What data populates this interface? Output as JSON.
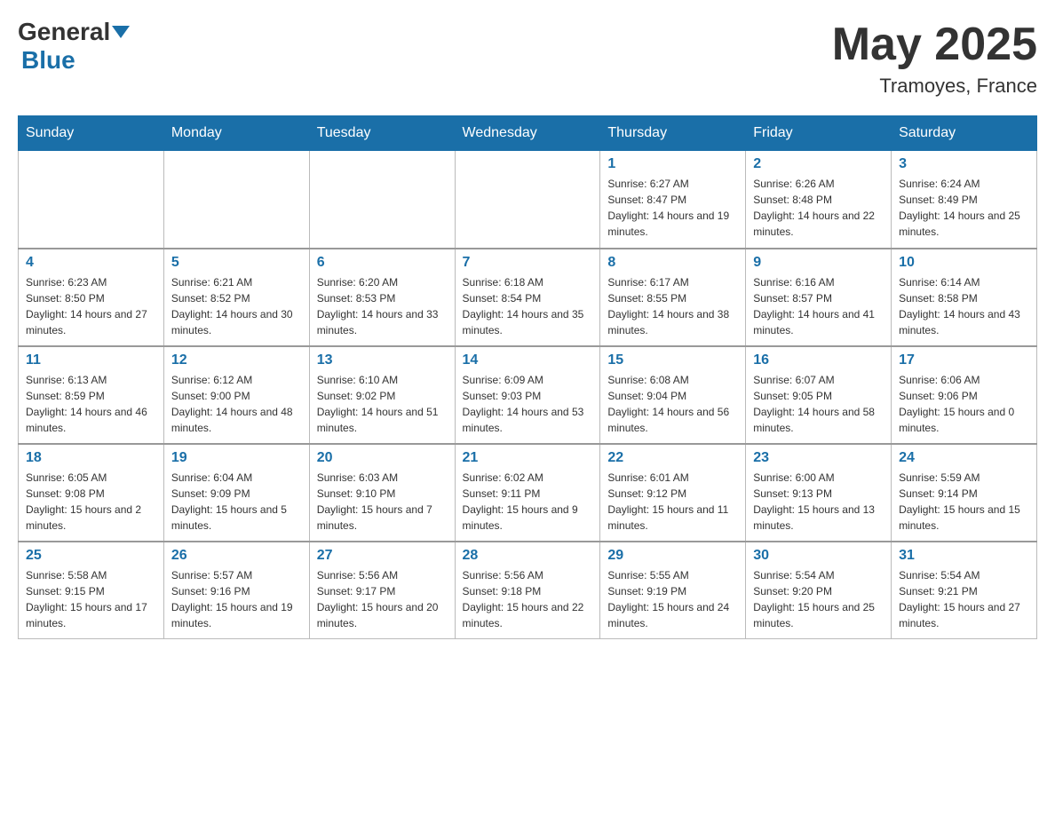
{
  "header": {
    "logo_general": "General",
    "logo_blue": "Blue",
    "month_title": "May 2025",
    "location": "Tramoyes, France"
  },
  "days_of_week": [
    "Sunday",
    "Monday",
    "Tuesday",
    "Wednesday",
    "Thursday",
    "Friday",
    "Saturday"
  ],
  "weeks": [
    [
      {
        "day": "",
        "info": ""
      },
      {
        "day": "",
        "info": ""
      },
      {
        "day": "",
        "info": ""
      },
      {
        "day": "",
        "info": ""
      },
      {
        "day": "1",
        "info": "Sunrise: 6:27 AM\nSunset: 8:47 PM\nDaylight: 14 hours and 19 minutes."
      },
      {
        "day": "2",
        "info": "Sunrise: 6:26 AM\nSunset: 8:48 PM\nDaylight: 14 hours and 22 minutes."
      },
      {
        "day": "3",
        "info": "Sunrise: 6:24 AM\nSunset: 8:49 PM\nDaylight: 14 hours and 25 minutes."
      }
    ],
    [
      {
        "day": "4",
        "info": "Sunrise: 6:23 AM\nSunset: 8:50 PM\nDaylight: 14 hours and 27 minutes."
      },
      {
        "day": "5",
        "info": "Sunrise: 6:21 AM\nSunset: 8:52 PM\nDaylight: 14 hours and 30 minutes."
      },
      {
        "day": "6",
        "info": "Sunrise: 6:20 AM\nSunset: 8:53 PM\nDaylight: 14 hours and 33 minutes."
      },
      {
        "day": "7",
        "info": "Sunrise: 6:18 AM\nSunset: 8:54 PM\nDaylight: 14 hours and 35 minutes."
      },
      {
        "day": "8",
        "info": "Sunrise: 6:17 AM\nSunset: 8:55 PM\nDaylight: 14 hours and 38 minutes."
      },
      {
        "day": "9",
        "info": "Sunrise: 6:16 AM\nSunset: 8:57 PM\nDaylight: 14 hours and 41 minutes."
      },
      {
        "day": "10",
        "info": "Sunrise: 6:14 AM\nSunset: 8:58 PM\nDaylight: 14 hours and 43 minutes."
      }
    ],
    [
      {
        "day": "11",
        "info": "Sunrise: 6:13 AM\nSunset: 8:59 PM\nDaylight: 14 hours and 46 minutes."
      },
      {
        "day": "12",
        "info": "Sunrise: 6:12 AM\nSunset: 9:00 PM\nDaylight: 14 hours and 48 minutes."
      },
      {
        "day": "13",
        "info": "Sunrise: 6:10 AM\nSunset: 9:02 PM\nDaylight: 14 hours and 51 minutes."
      },
      {
        "day": "14",
        "info": "Sunrise: 6:09 AM\nSunset: 9:03 PM\nDaylight: 14 hours and 53 minutes."
      },
      {
        "day": "15",
        "info": "Sunrise: 6:08 AM\nSunset: 9:04 PM\nDaylight: 14 hours and 56 minutes."
      },
      {
        "day": "16",
        "info": "Sunrise: 6:07 AM\nSunset: 9:05 PM\nDaylight: 14 hours and 58 minutes."
      },
      {
        "day": "17",
        "info": "Sunrise: 6:06 AM\nSunset: 9:06 PM\nDaylight: 15 hours and 0 minutes."
      }
    ],
    [
      {
        "day": "18",
        "info": "Sunrise: 6:05 AM\nSunset: 9:08 PM\nDaylight: 15 hours and 2 minutes."
      },
      {
        "day": "19",
        "info": "Sunrise: 6:04 AM\nSunset: 9:09 PM\nDaylight: 15 hours and 5 minutes."
      },
      {
        "day": "20",
        "info": "Sunrise: 6:03 AM\nSunset: 9:10 PM\nDaylight: 15 hours and 7 minutes."
      },
      {
        "day": "21",
        "info": "Sunrise: 6:02 AM\nSunset: 9:11 PM\nDaylight: 15 hours and 9 minutes."
      },
      {
        "day": "22",
        "info": "Sunrise: 6:01 AM\nSunset: 9:12 PM\nDaylight: 15 hours and 11 minutes."
      },
      {
        "day": "23",
        "info": "Sunrise: 6:00 AM\nSunset: 9:13 PM\nDaylight: 15 hours and 13 minutes."
      },
      {
        "day": "24",
        "info": "Sunrise: 5:59 AM\nSunset: 9:14 PM\nDaylight: 15 hours and 15 minutes."
      }
    ],
    [
      {
        "day": "25",
        "info": "Sunrise: 5:58 AM\nSunset: 9:15 PM\nDaylight: 15 hours and 17 minutes."
      },
      {
        "day": "26",
        "info": "Sunrise: 5:57 AM\nSunset: 9:16 PM\nDaylight: 15 hours and 19 minutes."
      },
      {
        "day": "27",
        "info": "Sunrise: 5:56 AM\nSunset: 9:17 PM\nDaylight: 15 hours and 20 minutes."
      },
      {
        "day": "28",
        "info": "Sunrise: 5:56 AM\nSunset: 9:18 PM\nDaylight: 15 hours and 22 minutes."
      },
      {
        "day": "29",
        "info": "Sunrise: 5:55 AM\nSunset: 9:19 PM\nDaylight: 15 hours and 24 minutes."
      },
      {
        "day": "30",
        "info": "Sunrise: 5:54 AM\nSunset: 9:20 PM\nDaylight: 15 hours and 25 minutes."
      },
      {
        "day": "31",
        "info": "Sunrise: 5:54 AM\nSunset: 9:21 PM\nDaylight: 15 hours and 27 minutes."
      }
    ]
  ]
}
